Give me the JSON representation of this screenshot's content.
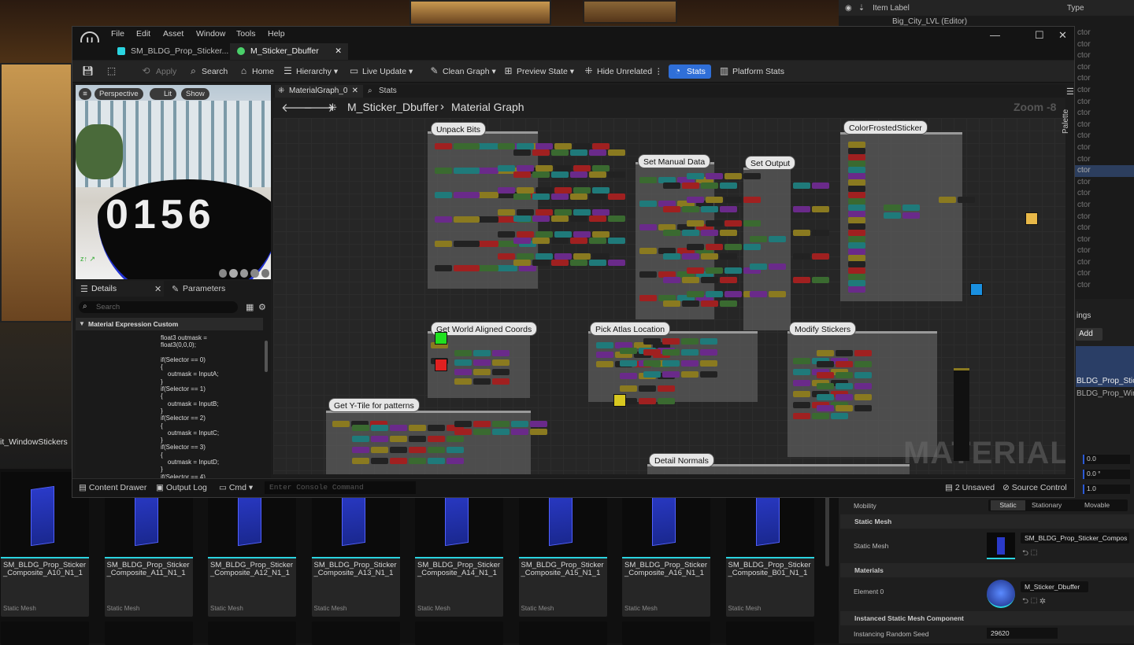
{
  "window": {
    "menu": [
      "File",
      "Edit",
      "Asset",
      "Window",
      "Tools",
      "Help"
    ],
    "tabs": [
      {
        "label": "SM_BLDG_Prop_Sticker..."
      },
      {
        "label": "M_Sticker_Dbuffer"
      }
    ]
  },
  "toolbar": {
    "apply": "Apply",
    "search": "Search",
    "home": "Home",
    "hierarchy": "Hierarchy",
    "live_update": "Live Update",
    "clean_graph": "Clean Graph",
    "preview_state": "Preview State",
    "hide_unrelated": "Hide Unrelated",
    "stats": "Stats",
    "platform_stats": "Platform Stats"
  },
  "viewport": {
    "perspective": "Perspective",
    "lit": "Lit",
    "show": "Show",
    "sphere_text": "0156"
  },
  "details": {
    "tab_details": "Details",
    "tab_parameters": "Parameters",
    "search_placeholder": "Search",
    "section": "Material Expression Custom",
    "code": "float3 outmask =\nfloat3(0,0,0);\n\nif(Selector == 0)\n{\n    outmask = InputA;\n}\nif(Selector == 1)\n{\n    outmask = InputB;\n}\nif(Selector == 2)\n{\n    outmask = InputC;\n}\nif(Selector == 3)\n{\n    outmask = InputD;\n}\nif(Selector == 4)"
  },
  "graph": {
    "tabs": [
      "MaterialGraph_0",
      "Stats"
    ],
    "crumb_root": "M_Sticker_Dbuffer",
    "crumb_leaf": "Material Graph",
    "zoom": "Zoom -8",
    "watermark": "MATERIAL",
    "palette": "Palette",
    "comments": [
      "Unpack Bits",
      "Set Manual Data",
      "Set  Output",
      "ColorFrostedSticker",
      "Get World Aligned Coords",
      "Pick Atlas Location",
      "Modify Stickers",
      "Get Y-Tile for patterns",
      "Detail Normals"
    ]
  },
  "statusbar": {
    "content_drawer": "Content Drawer",
    "output_log": "Output Log",
    "cmd": "Cmd",
    "console_placeholder": "Enter Console Command",
    "unsaved": "2 Unsaved",
    "source_control": "Source Control"
  },
  "outliner": {
    "item_label": "Item Label",
    "type": "Type",
    "row0": "Big_City_LVL (Editor)",
    "actor": "ctor"
  },
  "content_browser": {
    "folder": "it_WindowStickers",
    "assets": [
      {
        "name": "SM_BLDG_Prop_Sticker_Composite_A10_N1_1",
        "type": "Static Mesh"
      },
      {
        "name": "SM_BLDG_Prop_Sticker_Composite_A11_N1_1",
        "type": "Static Mesh"
      },
      {
        "name": "SM_BLDG_Prop_Sticker_Composite_A12_N1_1",
        "type": "Static Mesh"
      },
      {
        "name": "SM_BLDG_Prop_Sticker_Composite_A13_N1_1",
        "type": "Static Mesh"
      },
      {
        "name": "SM_BLDG_Prop_Sticker_Composite_A14_N1_1",
        "type": "Static Mesh"
      },
      {
        "name": "SM_BLDG_Prop_Sticker_Composite_A15_N1_1",
        "type": "Static Mesh"
      },
      {
        "name": "SM_BLDG_Prop_Sticker_Composite_A16_N1_1",
        "type": "Static Mesh"
      },
      {
        "name": "SM_BLDG_Prop_Sticker_Composite_B01_N1_1",
        "type": "Static Mesh"
      }
    ]
  },
  "properties": {
    "ings": "ings",
    "add": "Add",
    "stick1": "BLDG_Prop_Stick",
    "stick2": "BLDG_Prop_Windo",
    "v1": "0.0",
    "v2": "0.0 °",
    "v3": "1.0",
    "mobility": "Mobility",
    "static": "Static",
    "stationary": "Stationary",
    "movable": "Movable",
    "static_mesh_section": "Static Mesh",
    "static_mesh_label": "Static Mesh",
    "static_mesh_value": "SM_BLDG_Prop_Sticker_Compos",
    "materials_section": "Materials",
    "element0": "Element 0",
    "material_value": "M_Sticker_Dbuffer",
    "ism_section": "Instanced Static Mesh Component",
    "seed_label": "Instancing Random Seed",
    "seed_value": "29620"
  },
  "colors": {
    "accent": "#2f6fd8",
    "cyan": "#2ad4e0"
  }
}
